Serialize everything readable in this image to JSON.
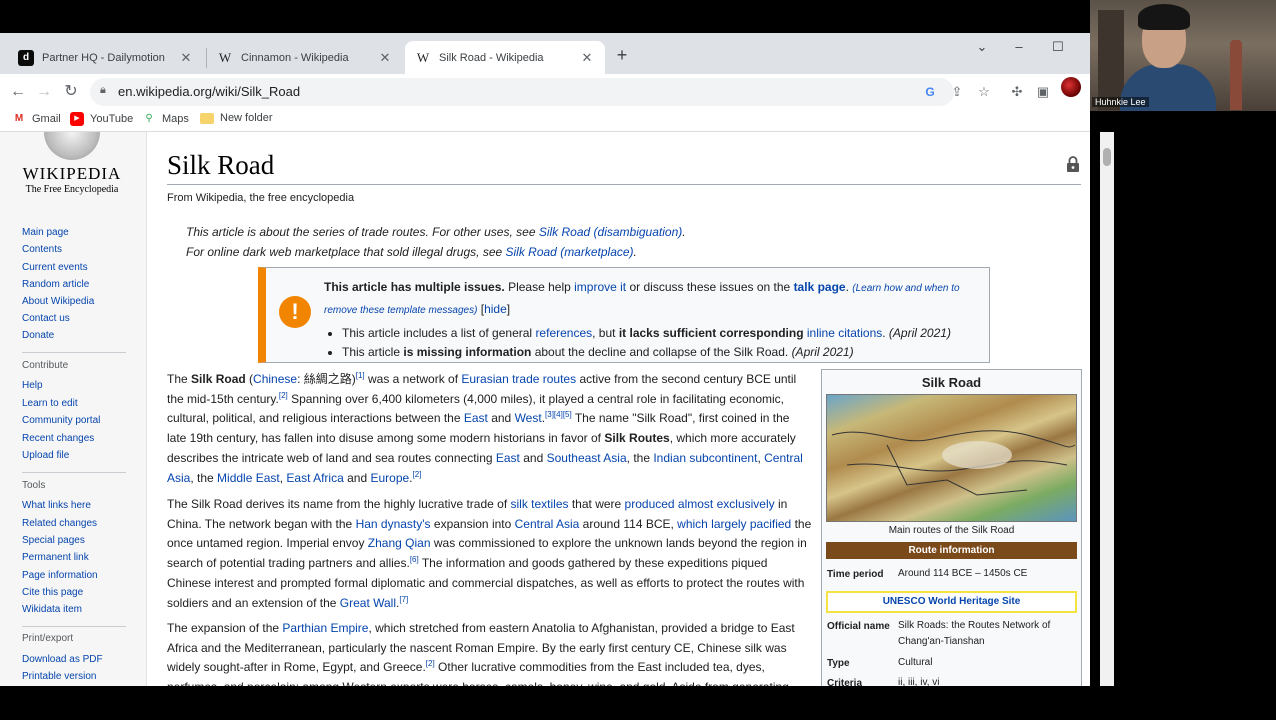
{
  "tabs": [
    {
      "title": "Partner HQ - Dailymotion",
      "favicon": "d"
    },
    {
      "title": "Cinnamon - Wikipedia",
      "favicon": "W"
    },
    {
      "title": "Silk Road - Wikipedia",
      "favicon": "W"
    }
  ],
  "address_bar": {
    "url": "en.wikipedia.org/wiki/Silk_Road"
  },
  "bookmarks": [
    {
      "label": "Gmail",
      "icon": "gmail-icon"
    },
    {
      "label": "YouTube",
      "icon": "youtube-icon"
    },
    {
      "label": "Maps",
      "icon": "maps-icon"
    },
    {
      "label": "New folder",
      "icon": "folder-icon"
    }
  ],
  "logo": {
    "wordmark": "Wikipedia",
    "tagline": "The Free Encyclopedia"
  },
  "sidebar": {
    "nav": [
      "Main page",
      "Contents",
      "Current events",
      "Random article",
      "About Wikipedia",
      "Contact us",
      "Donate"
    ],
    "contribute_heading": "Contribute",
    "contribute": [
      "Help",
      "Learn to edit",
      "Community portal",
      "Recent changes",
      "Upload file"
    ],
    "tools_heading": "Tools",
    "tools": [
      "What links here",
      "Related changes",
      "Special pages",
      "Permanent link",
      "Page information",
      "Cite this page",
      "Wikidata item"
    ],
    "print_heading": "Print/export",
    "print": [
      "Download as PDF",
      "Printable version"
    ]
  },
  "article": {
    "title": "Silk Road",
    "from": "From Wikipedia, the free encyclopedia",
    "hatnote1_prefix": "This article is about the series of trade routes. For other uses, see ",
    "hatnote1_link": "Silk Road (disambiguation)",
    "hatnote1_suffix": ".",
    "hatnote2_prefix": "For online dark web marketplace that sold illegal drugs, see ",
    "hatnote2_link": "Silk Road (marketplace)",
    "hatnote2_suffix": "."
  },
  "issues_box": {
    "heading": "This article has multiple issues.",
    "help_text": " Please help ",
    "improve_link": "improve it",
    "discuss_text": " or discuss these issues on the ",
    "talk_link": "talk page",
    "learn_text": "(Learn how and when to remove these template messages)",
    "hide_link": "hide",
    "issue1_a": "This article includes a list of general ",
    "issue1_link1": "references",
    "issue1_b": ", but ",
    "issue1_bold": "it lacks sufficient corresponding ",
    "issue1_link2": "inline citations",
    "issue1_date": "(April 2021)",
    "issue2_a": "This article ",
    "issue2_bold": "is missing information",
    "issue2_b": " about the decline and collapse of the Silk Road. ",
    "issue2_date": "(April 2021)"
  },
  "infobox": {
    "title": "Silk Road",
    "map_caption": "Main routes of the Silk Road",
    "route_header": "Route information",
    "time_period_label": "Time period",
    "time_period_value": "Around 114 BCE – 1450s CE",
    "unesco": "UNESCO World Heritage Site",
    "official_name_label": "Official name",
    "official_name_value": "Silk Roads: the Routes Network of Chang'an-Tianshan",
    "type_label": "Type",
    "type_value": "Cultural",
    "criteria_label": "Criteria",
    "criteria_value": "ii, iii, iv, vi"
  },
  "webcam": {
    "name": "Huhnkie Lee"
  }
}
